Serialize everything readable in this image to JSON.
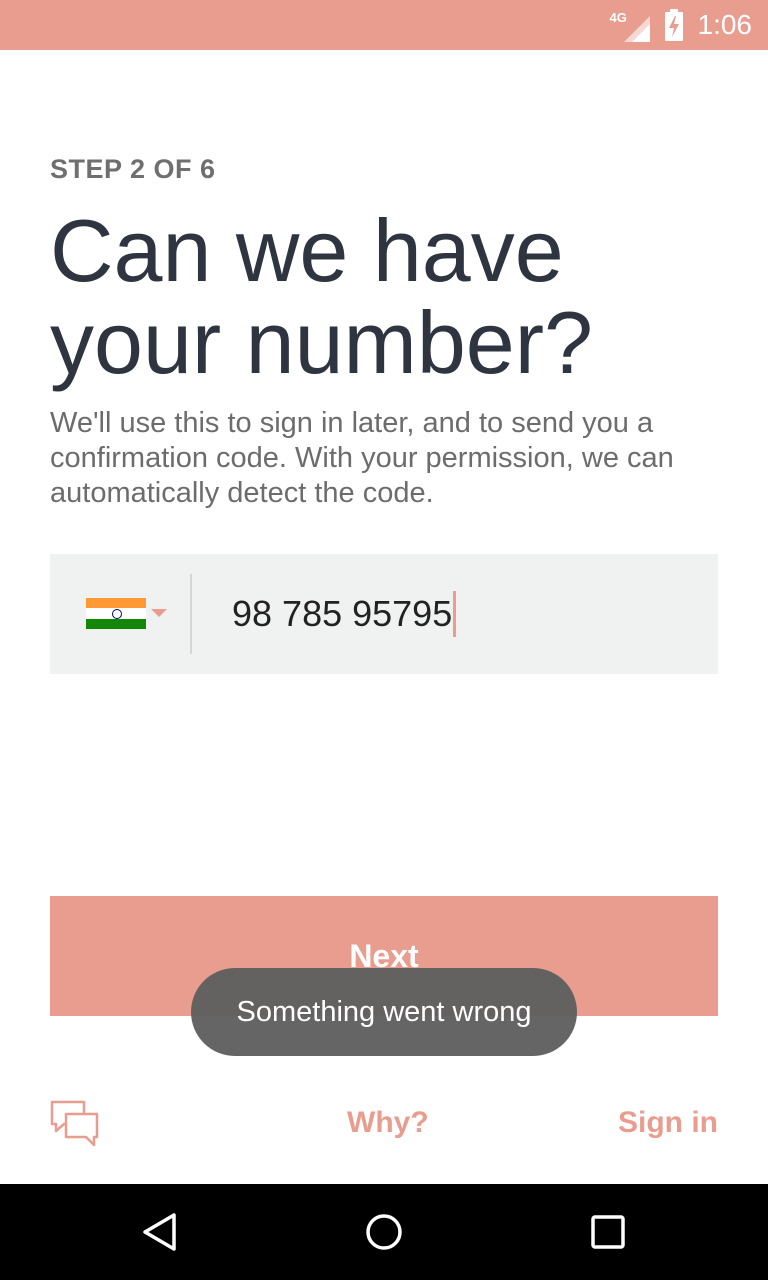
{
  "status_bar": {
    "network": "4G",
    "time": "1:06",
    "color": "#E89D8F"
  },
  "step_label": "STEP 2 OF 6",
  "headline": "Can we have your number?",
  "description": "We'll use this to sign in later, and to send you a confirmation code. With your permission, we can automatically detect the code.",
  "phone": {
    "country_flag": "india-flag-icon",
    "value": "98 785 95795"
  },
  "next_button_label": "Next",
  "toast_message": "Something went wrong",
  "footer": {
    "chat_icon": "chat-bubbles-icon",
    "why_label": "Why?",
    "signin_label": "Sign in"
  },
  "nav_bar": {
    "back": "back-triangle-icon",
    "home": "home-circle-icon",
    "recents": "recents-square-icon"
  },
  "accent_color": "#E89D8F"
}
